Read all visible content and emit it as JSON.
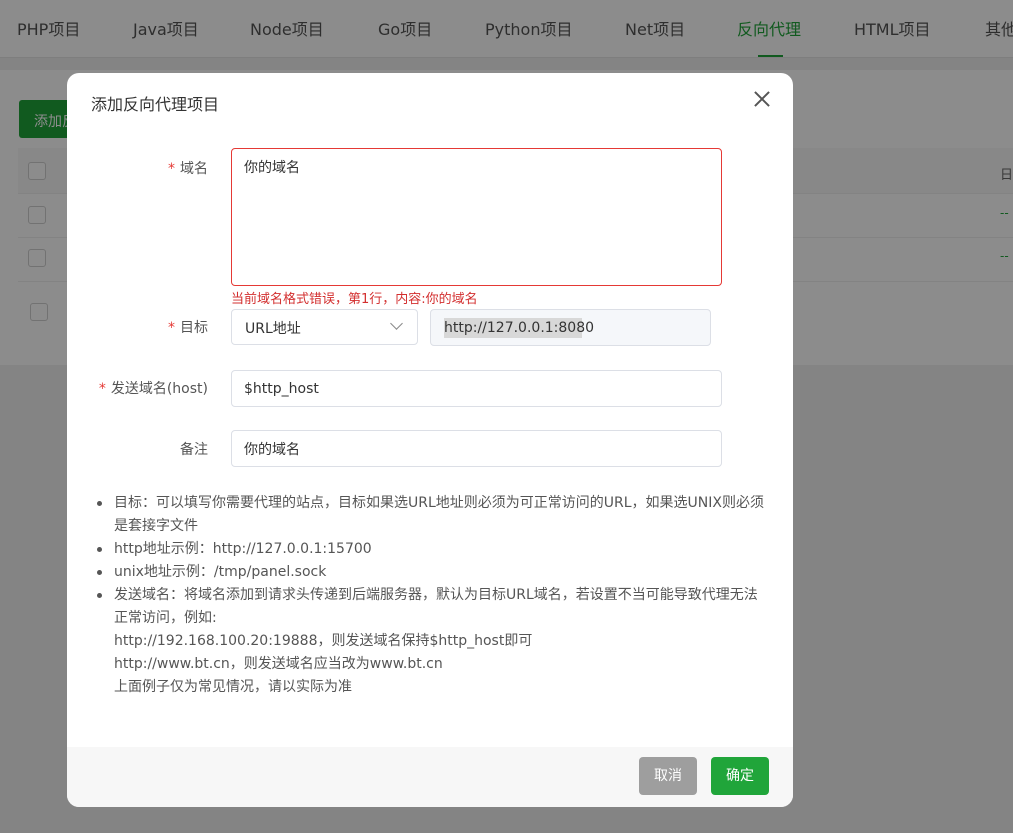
{
  "tabs": [
    {
      "label": "PHP项目"
    },
    {
      "label": "Java项目"
    },
    {
      "label": "Node项目"
    },
    {
      "label": "Go项目"
    },
    {
      "label": "Python项目"
    },
    {
      "label": "Net项目"
    },
    {
      "label": "反向代理"
    },
    {
      "label": "HTML项目"
    },
    {
      "label": "其他"
    }
  ],
  "background": {
    "add_button_label": "添加反",
    "column_header": "日"
  },
  "modal": {
    "title": "添加反向代理项目",
    "domain": {
      "label": "域名",
      "value": "你的域名",
      "error": "当前域名格式错误，第1行，内容:你的域名"
    },
    "target": {
      "label": "目标",
      "type_selected": "URL地址",
      "url_value": "http://127.0.0.1:8080"
    },
    "send_host": {
      "label": "发送域名(host)",
      "value": "$http_host"
    },
    "remark": {
      "label": "备注",
      "value": "你的域名"
    },
    "notes": [
      [
        "目标：可以填写你需要代理的站点，目标如果选URL地址则必须为可正常访问的URL，如果选UNIX则必须是套接字文件"
      ],
      [
        "http地址示例：http://127.0.0.1:15700"
      ],
      [
        "unix地址示例：/tmp/panel.sock"
      ],
      [
        "发送域名：将域名添加到请求头传递到后端服务器，默认为目标URL域名，若设置不当可能导致代理无法正常访问，例如:",
        "http://192.168.100.20:19888，则发送域名保持$http_host即可",
        "http://www.bt.cn，则发送域名应当改为www.bt.cn",
        "上面例子仅为常见情况，请以实际为准"
      ]
    ],
    "buttons": {
      "cancel": "取消",
      "confirm": "确定"
    }
  },
  "colors": {
    "accent": "#20a53a",
    "error": "#d32f2f",
    "cancel": "#9e9e9e"
  }
}
